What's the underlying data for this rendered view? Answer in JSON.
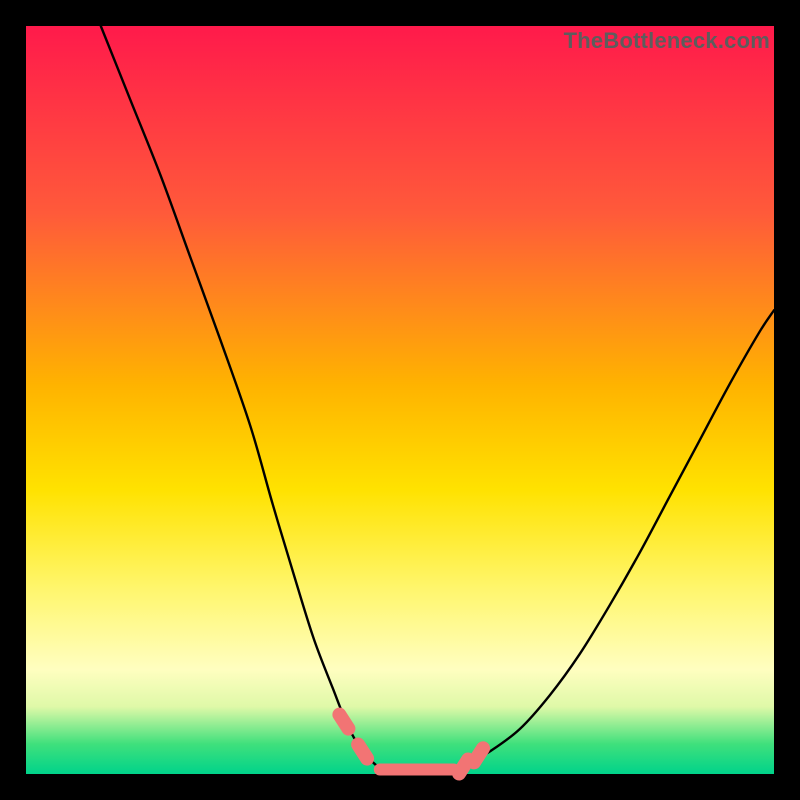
{
  "watermark": "TheBottleneck.com",
  "colors": {
    "background_frame": "#000000",
    "curve": "#000000",
    "marker": "#f27474",
    "gradient_top": "#ff1a4b",
    "gradient_bottom": "#00d38a"
  },
  "chart_data": {
    "type": "line",
    "title": "",
    "xlabel": "",
    "ylabel": "",
    "xlim": [
      0,
      100
    ],
    "ylim": [
      0,
      100
    ],
    "note": "Axes unmarked; values are visual estimates from pixel positions (0=left/bottom, 100=right/top).",
    "series": [
      {
        "name": "left-curve",
        "x": [
          10.0,
          14.0,
          18.0,
          22.0,
          26.0,
          30.0,
          33.0,
          36.0,
          38.5,
          41.0,
          43.0,
          45.0,
          47.0
        ],
        "values": [
          100.0,
          90.0,
          80.0,
          69.0,
          58.0,
          46.5,
          36.0,
          26.0,
          18.0,
          11.5,
          6.5,
          3.0,
          1.0
        ]
      },
      {
        "name": "valley-floor",
        "x": [
          47.0,
          49.0,
          51.0,
          53.0,
          55.0,
          57.0,
          59.0
        ],
        "values": [
          1.0,
          0.5,
          0.4,
          0.4,
          0.5,
          0.8,
          1.3
        ]
      },
      {
        "name": "right-curve",
        "x": [
          59.0,
          62.0,
          66.0,
          70.0,
          74.0,
          78.0,
          82.0,
          86.0,
          90.0,
          94.0,
          98.0,
          100.0
        ],
        "values": [
          1.3,
          3.0,
          6.0,
          10.5,
          16.0,
          22.5,
          29.5,
          37.0,
          44.5,
          52.0,
          59.0,
          62.0
        ]
      }
    ],
    "markers": [
      {
        "name": "left-marker-upper",
        "x": 42.5,
        "y": 7.0
      },
      {
        "name": "left-marker-lower",
        "x": 45.0,
        "y": 3.0
      },
      {
        "name": "right-marker-upper",
        "x": 60.5,
        "y": 2.5
      },
      {
        "name": "right-marker-lower",
        "x": 58.5,
        "y": 1.0
      }
    ],
    "valley_span": {
      "x_start": 46.5,
      "x_end": 58.0,
      "y": 0.6
    }
  }
}
